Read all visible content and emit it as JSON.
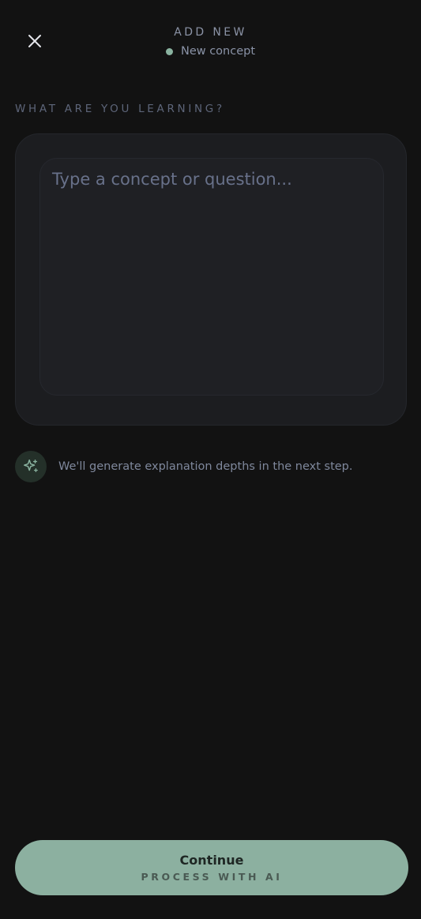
{
  "header": {
    "title": "ADD NEW",
    "subtitle": "New concept",
    "status_color": "#8ab3a0",
    "close_icon": "close-icon"
  },
  "form": {
    "section_label": "WHAT ARE YOU LEARNING?",
    "input": {
      "value": "",
      "placeholder": "Type a concept or question..."
    }
  },
  "hint": {
    "icon": "sparkles-icon",
    "text": "We'll generate explanation depths in the next step."
  },
  "continue_button": {
    "label": "Continue",
    "sublabel": "PROCESS WITH AI",
    "color": "#8cb0a0"
  }
}
